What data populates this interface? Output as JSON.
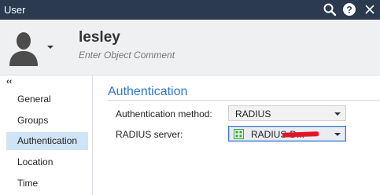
{
  "window": {
    "title": "User",
    "icons": [
      "search-icon",
      "help-icon",
      "close-icon"
    ]
  },
  "header": {
    "username": "lesley",
    "comment_placeholder": "Enter Object Comment"
  },
  "sidebar": {
    "collapse_glyph": "‹‹",
    "items": [
      {
        "label": "General",
        "active": false
      },
      {
        "label": "Groups",
        "active": false
      },
      {
        "label": "Authentication",
        "active": true
      },
      {
        "label": "Location",
        "active": false
      },
      {
        "label": "Time",
        "active": false
      }
    ]
  },
  "main": {
    "section_title": "Authentication",
    "auth_method": {
      "label": "Authentication method:",
      "value": "RADIUS"
    },
    "radius_server": {
      "label": "RADIUS server:",
      "value": "RADIUS-D..."
    }
  },
  "colors": {
    "titlebar": "#2b3a4f",
    "accent": "#2f77c2",
    "active_item": "#cfe5f6",
    "header_bg": "#eef0f2",
    "redaction": "#e3142a"
  }
}
